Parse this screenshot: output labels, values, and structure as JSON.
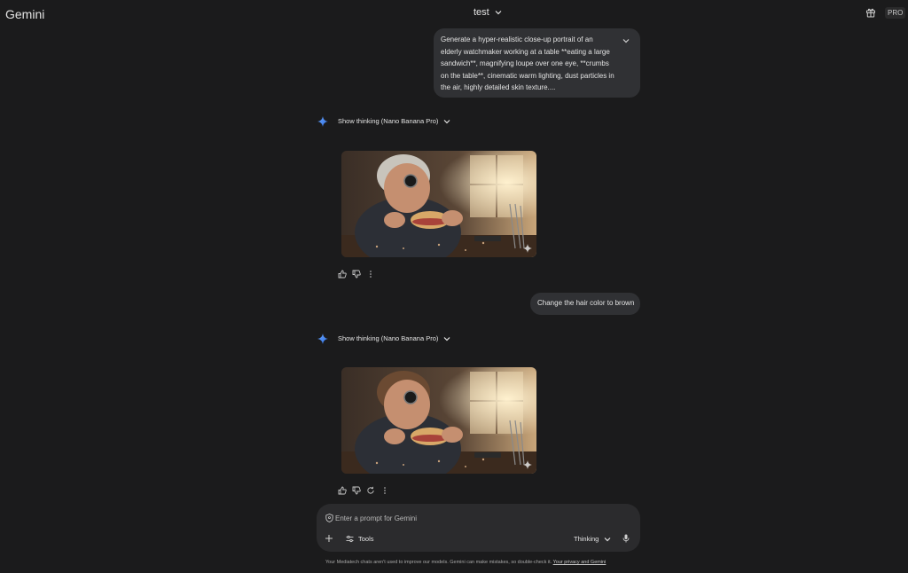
{
  "app": {
    "brand": "Gemini",
    "badge": "PRO"
  },
  "header": {
    "conversation_title": "test"
  },
  "messages": [
    {
      "role": "user",
      "text": "Generate a hyper-realistic close-up portrait of an elderly watchmaker working at a table **eating a large sandwich**, magnifying loupe over one eye, **crumbs on the table**, cinematic warm lighting, dust particles in the air, highly detailed skin texture...."
    },
    {
      "role": "model",
      "thinking_label": "Show thinking (Nano Banana Pro)",
      "image_alt": "Elderly watchmaker with gray hair wearing a loupe, eating a large sandwich at a workbench"
    },
    {
      "role": "user",
      "text": "Change the hair color to brown"
    },
    {
      "role": "model",
      "thinking_label": "Show thinking (Nano Banana Pro)",
      "image_alt": "Elderly watchmaker with brown hair wearing a loupe, eating a large sandwich at a workbench"
    }
  ],
  "composer": {
    "placeholder": "Enter a prompt for Gemini",
    "tools_label": "Tools",
    "mode_label": "Thinking"
  },
  "footer": {
    "text": "Your Mediatech chats aren't used to improve our models. Gemini can make mistakes, so double-check it. ",
    "link": "Your privacy and Gemini"
  },
  "colors": {
    "background": "#1b1b1c",
    "bubble": "#303134",
    "composer": "#2b2b2d",
    "sparkle_blue": "#4a8cff"
  },
  "icons": [
    "chevron-down-icon",
    "gift-icon",
    "sparkle-icon",
    "thumbs-up-icon",
    "thumbs-down-icon",
    "more-vert-icon",
    "refresh-icon",
    "shield-icon",
    "plus-icon",
    "tools-icon",
    "mic-icon",
    "image-sparkle-icon"
  ]
}
